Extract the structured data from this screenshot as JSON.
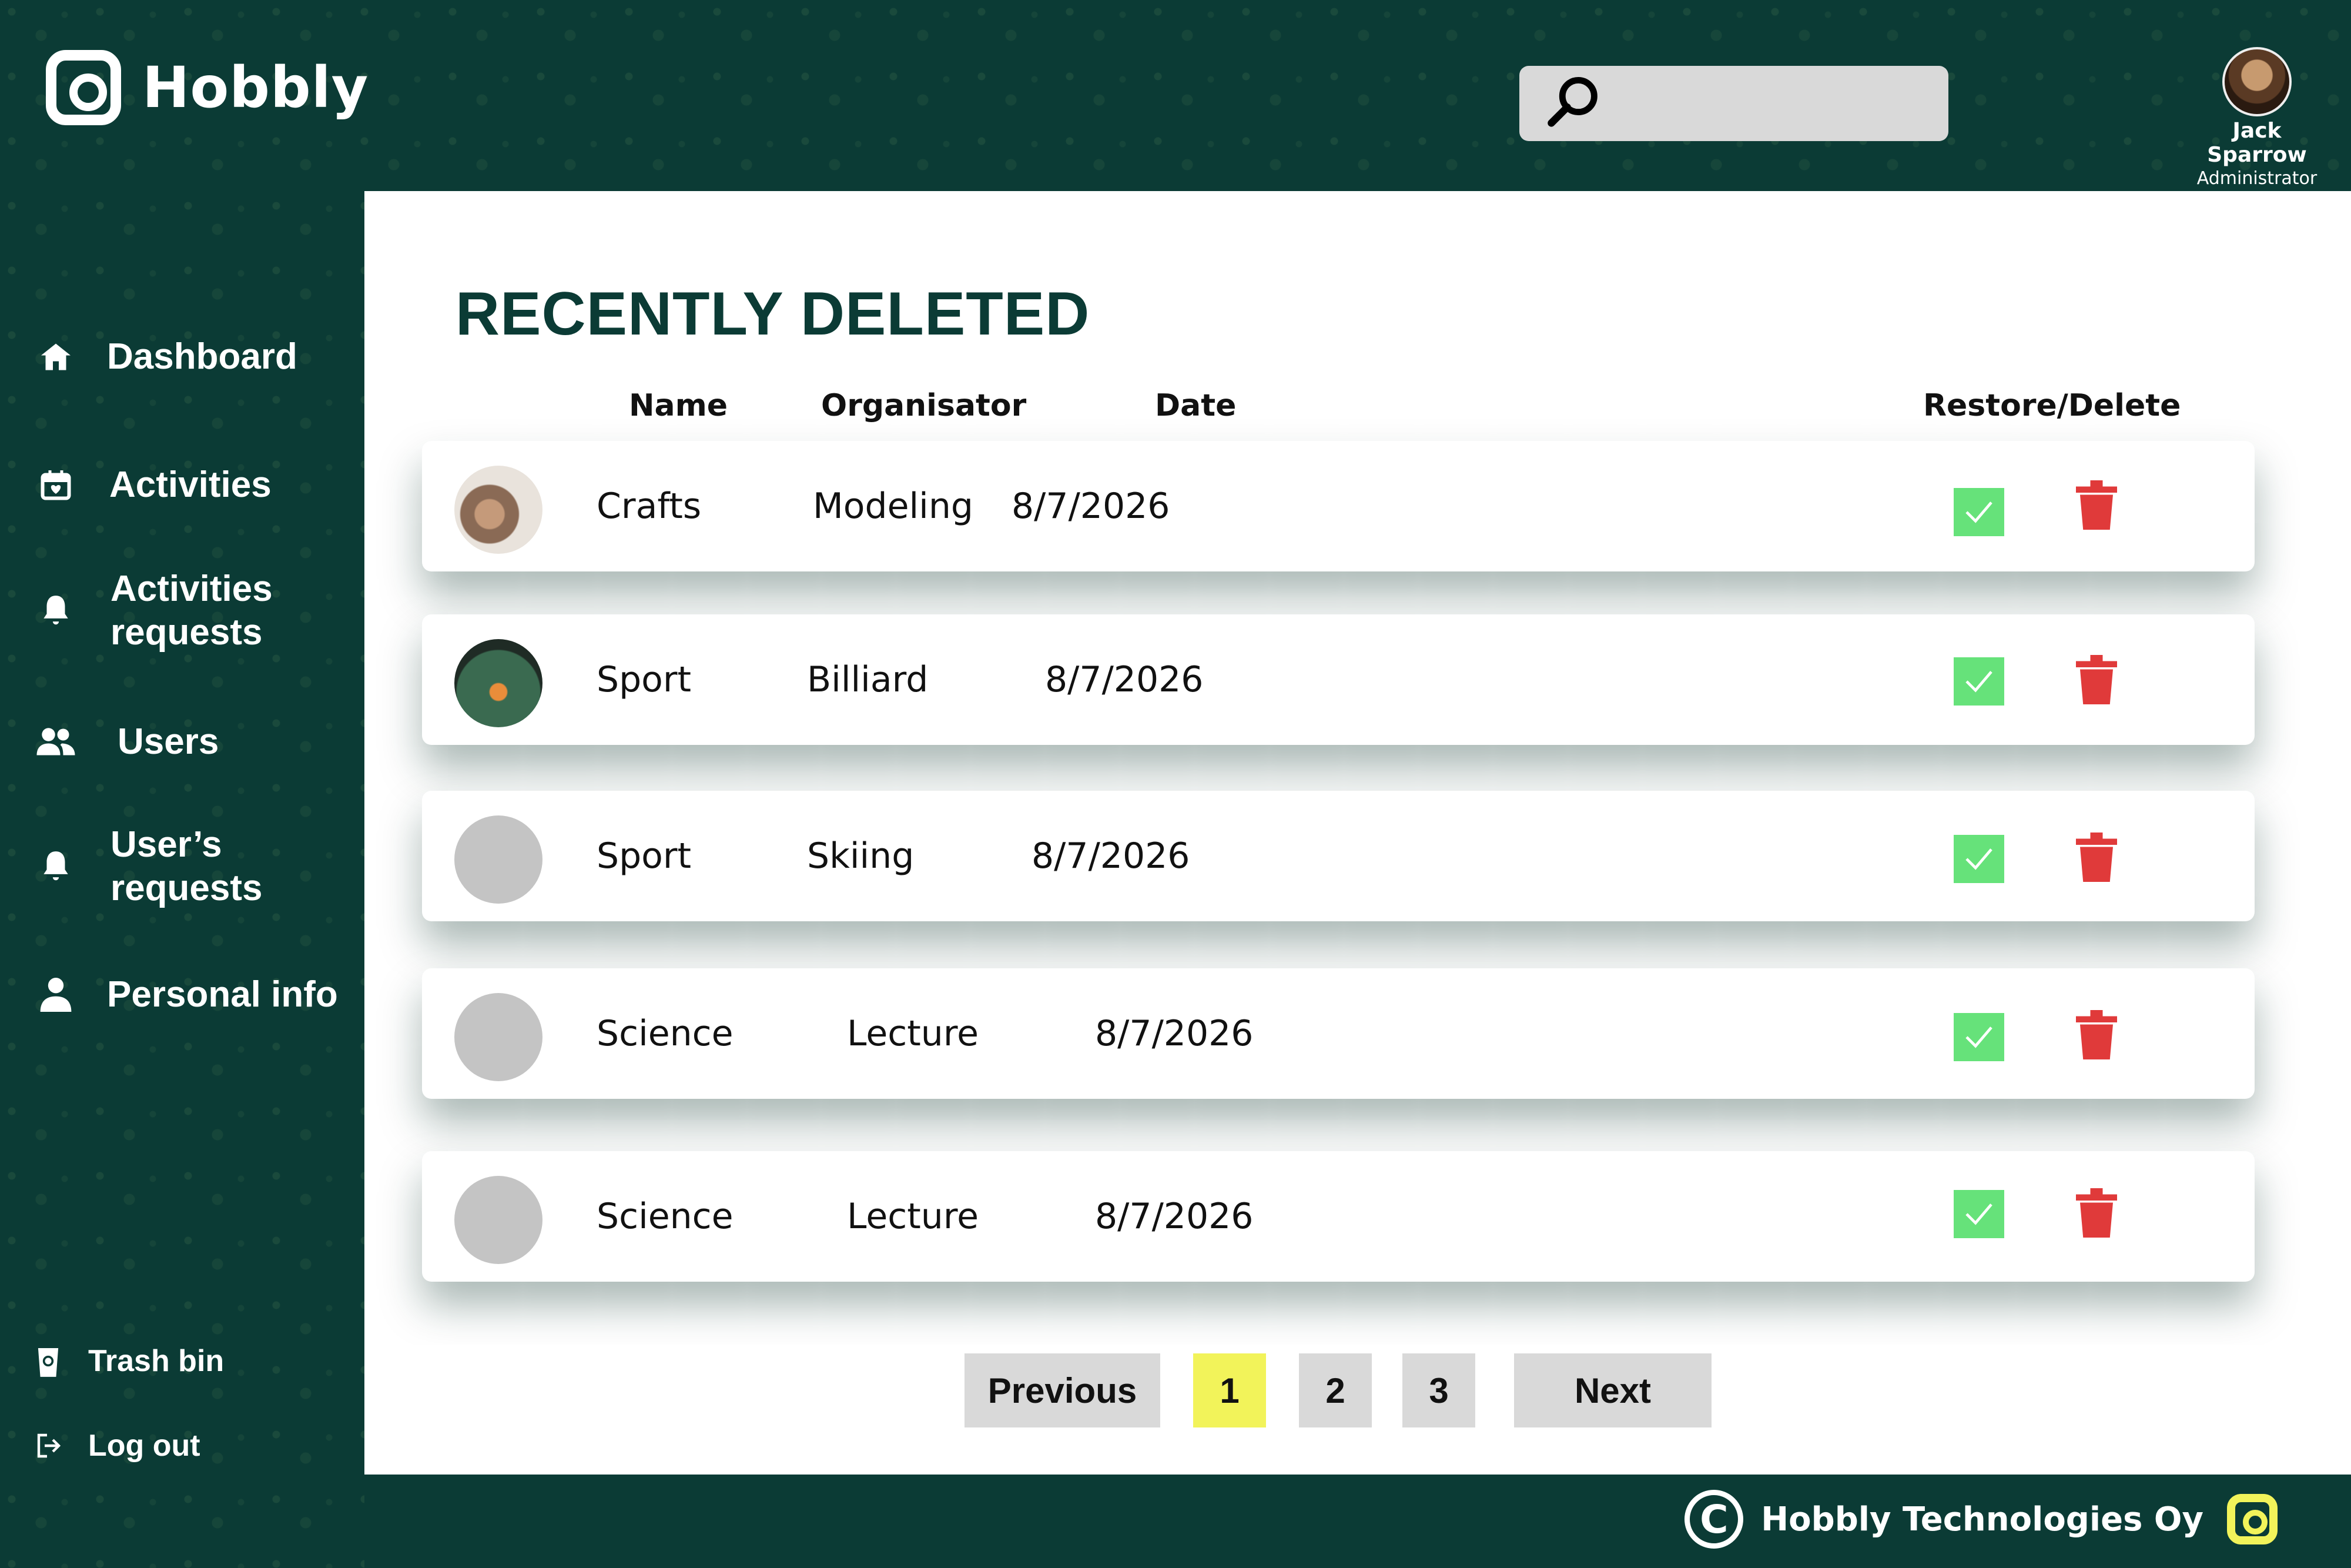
{
  "app": {
    "name": "Hobbly"
  },
  "search": {
    "placeholder": "",
    "value": ""
  },
  "user": {
    "name": "Jack Sparrow",
    "role": "Administrator"
  },
  "sidebar": {
    "items": [
      {
        "label": "Dashboard",
        "icon": "home-icon"
      },
      {
        "label": "Activities",
        "icon": "calendar-heart-icon"
      },
      {
        "label": "Activities requests",
        "icon": "bell-icon"
      },
      {
        "label": "Users",
        "icon": "users-icon"
      },
      {
        "label": "User’s requests",
        "icon": "bell-icon"
      },
      {
        "label": "Personal info",
        "icon": "person-icon"
      }
    ],
    "bottom": [
      {
        "label": "Trash bin",
        "icon": "trash-bin-icon"
      },
      {
        "label": "Log out",
        "icon": "logout-icon"
      }
    ]
  },
  "main": {
    "title": "RECENTLY DELETED",
    "columns": {
      "name": "Name",
      "organisator": "Organisator",
      "date": "Date",
      "actions": "Restore/Delete"
    },
    "rows": [
      {
        "name": "Crafts",
        "organisator": "Modeling",
        "date": "8/7/2026",
        "image": "crafts"
      },
      {
        "name": "Sport",
        "organisator": "Billiard",
        "date": "8/7/2026",
        "image": "billiard"
      },
      {
        "name": "Sport",
        "organisator": "Skiing",
        "date": "8/7/2026",
        "image": "placeholder"
      },
      {
        "name": "Science",
        "organisator": "Lecture",
        "date": "8/7/2026",
        "image": "placeholder"
      },
      {
        "name": "Science",
        "organisator": "Lecture",
        "date": "8/7/2026",
        "image": "placeholder"
      }
    ]
  },
  "pagination": {
    "previous": "Previous",
    "pages": [
      "1",
      "2",
      "3"
    ],
    "current": "1",
    "next": "Next"
  },
  "footer": {
    "text": "Hobbly Technologies Oy",
    "copyright_symbol": "C"
  },
  "colors": {
    "primary_dark": "#0b3b35",
    "restore": "#66e27a",
    "delete": "#e03a3a",
    "active_page": "#f2f35a",
    "accent_logo": "#f2f35a"
  }
}
